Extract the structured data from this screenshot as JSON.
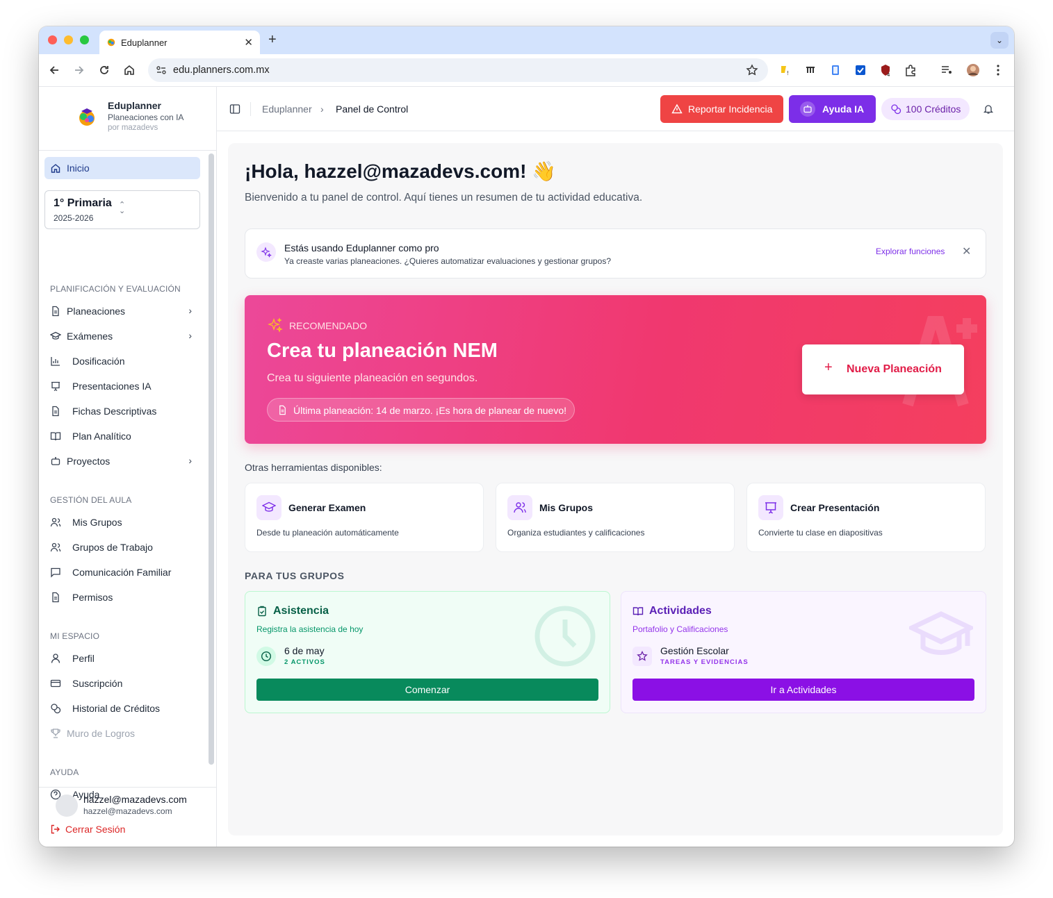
{
  "browser": {
    "tab_title": "Eduplanner",
    "url": "edu.planners.com.mx"
  },
  "sidebar": {
    "brand_name": "Eduplanner",
    "brand_sub": "Planeaciones con IA",
    "brand_by": "por mazadevs",
    "home": "Inicio",
    "grade": {
      "title": "1° Primaria",
      "year": "2025-2026"
    },
    "sections": [
      {
        "title": "PLANIFICACIÓN Y EVALUACIÓN"
      },
      {
        "title": "GESTIÓN DEL AULA"
      },
      {
        "title": "MI ESPACIO"
      },
      {
        "title": "AYUDA"
      }
    ],
    "items": {
      "planeaciones": "Planeaciones",
      "examenes": "Exámenes",
      "dosificacion": "Dosificación",
      "presentaciones": "Presentaciones IA",
      "fichas": "Fichas Descriptivas",
      "plan": "Plan Analítico",
      "proyectos": "Proyectos",
      "mis_grupos": "Mis Grupos",
      "grupos_trabajo": "Grupos de Trabajo",
      "comunicacion": "Comunicación Familiar",
      "permisos": "Permisos",
      "perfil": "Perfil",
      "suscripcion": "Suscripción",
      "historial": "Historial de Créditos",
      "muro": "Muro de Logros",
      "ayuda": "Ayuda"
    },
    "user": {
      "name": "hazzel@mazadevs.com",
      "email": "hazzel@mazadevs.com",
      "logout": "Cerrar Sesión"
    }
  },
  "header": {
    "breadcrumb_root": "Eduplanner",
    "breadcrumb_current": "Panel de Control",
    "report_label": "Reportar Incidencia",
    "ai_label": "Ayuda IA",
    "credits_label": "100 Créditos"
  },
  "main": {
    "greeting": "¡Hola, hazzel@mazadevs.com! 👋",
    "welcome": "Bienvenido a tu panel de control. Aquí tienes un resumen de tu actividad educativa.",
    "pro": {
      "title": "Estás usando Eduplanner como pro",
      "desc": "Ya creaste varias planeaciones. ¿Quieres automatizar evaluaciones y gestionar grupos?",
      "link": "Explorar funciones"
    },
    "hero": {
      "badge": "RECOMENDADO",
      "title": "Crea tu planeación NEM",
      "subtitle": "Crea tu siguiente planeación en segundos.",
      "last": "Última planeación: 14 de marzo. ¡Es hora de planear de nuevo!",
      "button": "Nueva Planeación"
    },
    "other_title": "Otras herramientas disponibles:",
    "tools": [
      {
        "title": "Generar Examen",
        "desc": "Desde tu planeación automáticamente"
      },
      {
        "title": "Mis Grupos",
        "desc": "Organiza estudiantes y calificaciones"
      },
      {
        "title": "Crear Presentación",
        "desc": "Convierte tu clase en diapositivas"
      }
    ],
    "groups_title": "PARA TUS GRUPOS",
    "asistencia": {
      "title": "Asistencia",
      "subtitle": "Registra la asistencia de hoy",
      "date": "6 de may",
      "count": "2 ACTIVOS",
      "button": "Comenzar"
    },
    "actividades": {
      "title": "Actividades",
      "subtitle": "Portafolio y Calificaciones",
      "item": "Gestión Escolar",
      "tag": "TAREAS Y EVIDENCIAS",
      "button": "Ir a Actividades"
    }
  },
  "colors": {
    "accent_purple": "#7c2ee8",
    "report_red": "#ef4444",
    "hero_pink": "#ec4899",
    "hero_red": "#f43f5e",
    "green": "#088a5c",
    "activities_purple": "#8b10e5"
  }
}
